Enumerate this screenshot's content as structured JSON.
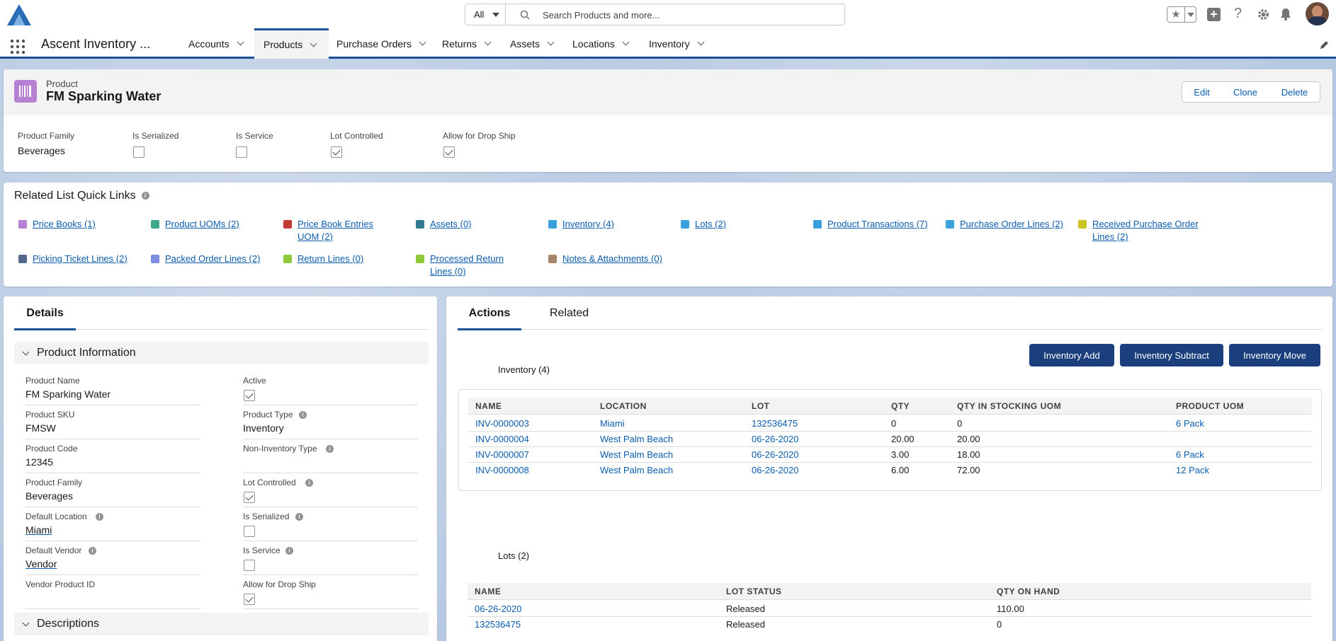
{
  "header": {
    "search_scope": "All",
    "search_placeholder": "Search Products and more..."
  },
  "nav": {
    "app_name": "Ascent Inventory ...",
    "tabs": [
      {
        "label": "Accounts"
      },
      {
        "label": "Products"
      },
      {
        "label": "Purchase Orders"
      },
      {
        "label": "Returns"
      },
      {
        "label": "Assets"
      },
      {
        "label": "Locations"
      },
      {
        "label": "Inventory"
      }
    ],
    "active_tab": "Products"
  },
  "record": {
    "object_label": "Product",
    "name": "FM Sparking Water",
    "buttons": {
      "edit": "Edit",
      "clone": "Clone",
      "delete": "Delete"
    },
    "highlights": {
      "product_family_label": "Product Family",
      "product_family_value": "Beverages",
      "is_serialized_label": "Is Serialized",
      "is_service_label": "Is Service",
      "lot_controlled_label": "Lot Controlled",
      "drop_ship_label": "Allow for Drop Ship",
      "is_serialized": false,
      "is_service": false,
      "lot_controlled": true,
      "drop_ship": true
    }
  },
  "quicklinks": {
    "title": "Related List Quick Links",
    "items": [
      {
        "label": "Price Books (1)",
        "color": "#b781d3"
      },
      {
        "label": "Product UOMs (2)",
        "color": "#3ba889"
      },
      {
        "label": "Price Book Entries",
        "label2": "UOM (2)",
        "color": "#c23934"
      },
      {
        "label": "Assets (0)",
        "color": "#317a92"
      },
      {
        "label": "Inventory (4)",
        "color": "#3aa0dc"
      },
      {
        "label": "Lots (2)",
        "color": "#3aa0dc"
      },
      {
        "label": "Product Transactions (7)",
        "color": "#3aa0dc"
      },
      {
        "label": "Purchase Order Lines (2)",
        "color": "#3aa0dc"
      },
      {
        "label": "Received Purchase Order",
        "label2": "Lines (2)",
        "color": "#c9c41f"
      },
      {
        "label": "Picking Ticket Lines (2)",
        "color": "#54698d"
      },
      {
        "label": "Packed Order Lines (2)",
        "color": "#7f8de1"
      },
      {
        "label": "Return Lines (0)",
        "color": "#8fc93a"
      },
      {
        "label": "Processed Return",
        "label2": "Lines (0)",
        "color": "#8fc93a"
      },
      {
        "label": "Notes & Attachments (0)",
        "color": "#a5866b"
      }
    ]
  },
  "details": {
    "tab_label": "Details",
    "section_title": "Product Information",
    "section2_title": "Descriptions",
    "left_fields": [
      {
        "label": "Product Name",
        "value": "FM Sparking Water"
      },
      {
        "label": "Product SKU",
        "value": "FMSW"
      },
      {
        "label": "Product Code",
        "value": "12345"
      },
      {
        "label": "Product Family",
        "value": "Beverages"
      },
      {
        "label": "Default Location",
        "value": "Miami"
      },
      {
        "label": "Default Vendor",
        "value": "Vendor"
      },
      {
        "label": "Vendor Product ID",
        "value": ""
      }
    ],
    "right_fields": [
      {
        "label": "Active",
        "checked": true
      },
      {
        "label": "Product Type",
        "value": "Inventory"
      },
      {
        "label": "Non-Inventory Type",
        "value": ""
      },
      {
        "label": "Lot Controlled",
        "checked": true
      },
      {
        "label": "Is Serialized",
        "checked": false
      },
      {
        "label": "Is Service",
        "checked": false
      },
      {
        "label": "Allow for Drop Ship",
        "checked": true
      }
    ]
  },
  "actions_panel": {
    "tabs": [
      "Actions",
      "Related"
    ],
    "buttons": [
      "Inventory Add",
      "Inventory Subtract",
      "Inventory Move"
    ],
    "inventory": {
      "title": "Inventory (4)",
      "columns": [
        "NAME",
        "LOCATION",
        "LOT",
        "QTY",
        "QTY IN STOCKING UOM",
        "PRODUCT UOM"
      ],
      "rows": [
        [
          "INV-0000003",
          "Miami",
          "132536475",
          "0",
          "0",
          "6 Pack"
        ],
        [
          "INV-0000004",
          "West Palm Beach",
          "06-26-2020",
          "20.00",
          "20.00",
          ""
        ],
        [
          "INV-0000007",
          "West Palm Beach",
          "06-26-2020",
          "3.00",
          "18.00",
          "6 Pack"
        ],
        [
          "INV-0000008",
          "West Palm Beach",
          "06-26-2020",
          "6.00",
          "72.00",
          "12 Pack"
        ]
      ]
    },
    "lots": {
      "title": "Lots (2)",
      "columns": [
        "NAME",
        "LOT STATUS",
        "QTY ON HAND"
      ],
      "rows": [
        [
          "06-26-2020",
          "Released",
          "110.00"
        ],
        [
          "132536475",
          "Released",
          "0"
        ]
      ]
    }
  }
}
